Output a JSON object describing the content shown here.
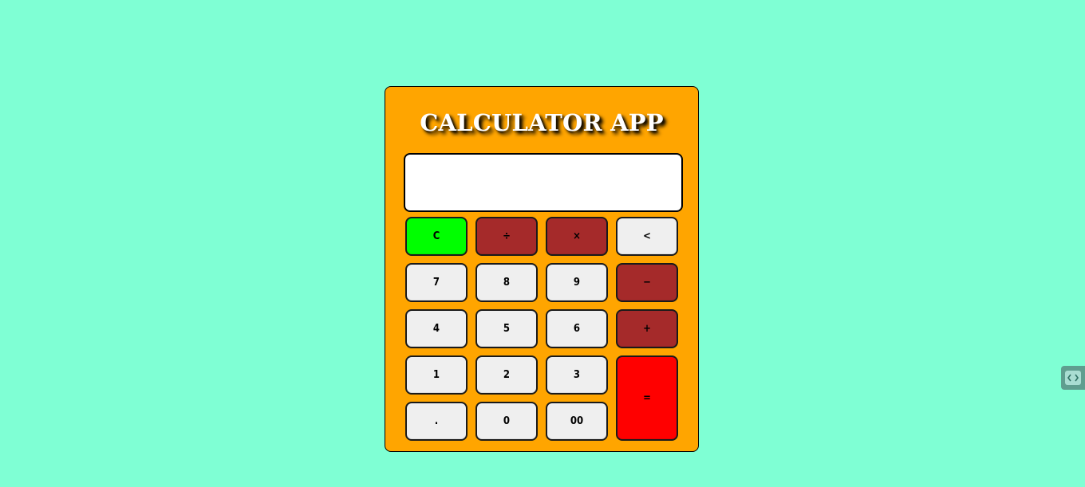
{
  "app": {
    "title": "CALCULATOR APP"
  },
  "display": {
    "value": ""
  },
  "buttons": {
    "clear": "C",
    "divide": "÷",
    "multiply": "×",
    "backspace": "<",
    "seven": "7",
    "eight": "8",
    "nine": "9",
    "minus": "−",
    "four": "4",
    "five": "5",
    "six": "6",
    "plus": "+",
    "one": "1",
    "two": "2",
    "three": "3",
    "equals": "=",
    "decimal": ".",
    "zero": "0",
    "double_zero": "00"
  },
  "colors": {
    "page_background": "#7fffd4",
    "calculator_body": "#ffa500",
    "clear_button": "#00ff00",
    "operator_button": "#a52a2a",
    "equals_button": "#ff0000",
    "default_button": "#efefef"
  },
  "icons": {
    "side_widget": "code-icon"
  }
}
